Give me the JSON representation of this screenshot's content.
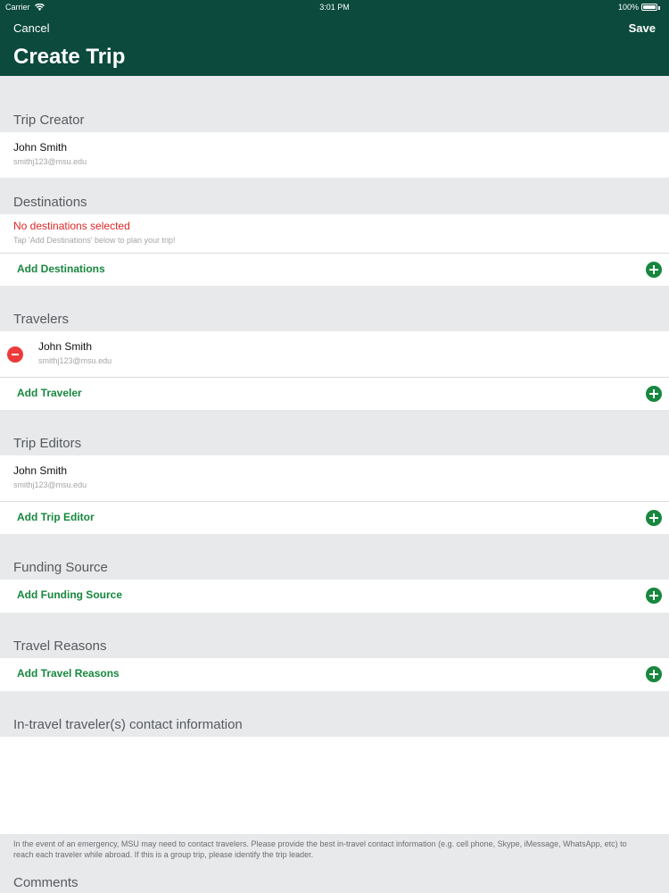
{
  "status_bar": {
    "carrier": "Carrier",
    "time": "3:01 PM",
    "battery": "100%"
  },
  "nav": {
    "cancel": "Cancel",
    "save": "Save",
    "title": "Create Trip"
  },
  "trip_creator": {
    "header": "Trip Creator",
    "name": "John Smith",
    "email": "smithj123@msu.edu"
  },
  "destinations": {
    "header": "Destinations",
    "empty_message": "No destinations selected",
    "hint": "Tap 'Add Destinations' below to plan your trip!",
    "add_label": "Add Destinations"
  },
  "travelers": {
    "header": "Travelers",
    "name": "John Smith",
    "email": "smithj123@msu.edu",
    "add_label": "Add Traveler"
  },
  "trip_editors": {
    "header": "Trip Editors",
    "name": "John Smith",
    "email": "smithj123@msu.edu",
    "add_label": "Add Trip Editor"
  },
  "funding_source": {
    "header": "Funding Source",
    "add_label": "Add Funding Source"
  },
  "travel_reasons": {
    "header": "Travel Reasons",
    "add_label": "Add Travel Reasons"
  },
  "contact_info": {
    "header": "In-travel traveler(s) contact information",
    "note": "In the event of an emergency, MSU may need to contact travelers. Please provide the best in-travel contact information (e.g. cell phone, Skype, iMessage, WhatsApp, etc) to reach each traveler while abroad. If this is a group trip, please identify the trip leader."
  },
  "comments": {
    "header": "Comments"
  },
  "colors": {
    "header_bg": "#0b4a3d",
    "accent_green": "#17873e",
    "error_red": "#e02626",
    "background": "#e8e9eb"
  },
  "icons": {
    "add": "plus-circle-icon",
    "remove": "minus-circle-icon",
    "wifi": "wifi-icon",
    "battery": "battery-icon"
  }
}
